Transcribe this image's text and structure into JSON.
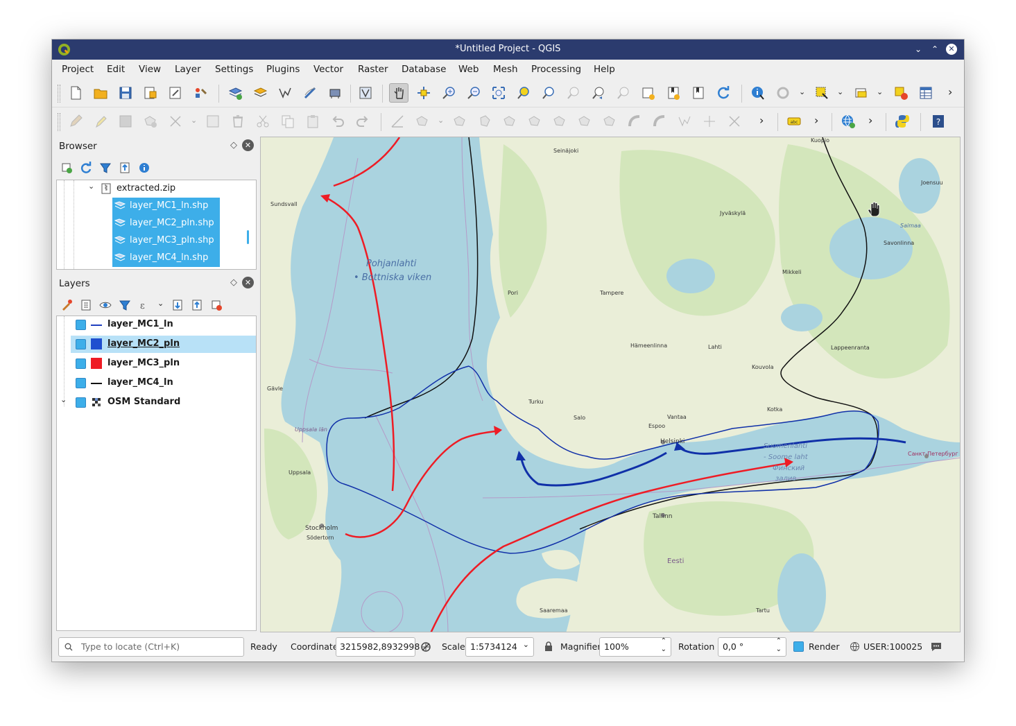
{
  "window": {
    "title": "*Untitled Project - QGIS"
  },
  "menu": [
    "Project",
    "Edit",
    "View",
    "Layer",
    "Settings",
    "Plugins",
    "Vector",
    "Raster",
    "Database",
    "Web",
    "Mesh",
    "Processing",
    "Help"
  ],
  "browser": {
    "title": "Browser",
    "archive": "extracted.zip",
    "files": [
      "layer_MC1_ln.shp",
      "layer_MC2_pln.shp",
      "layer_MC3_pln.shp",
      "layer_MC4_ln.shp"
    ]
  },
  "layers": {
    "title": "Layers",
    "items": [
      {
        "name": "layer_MC1_ln",
        "symbol": "line",
        "color": "#1f3fbf",
        "checked": true,
        "selected": false
      },
      {
        "name": "layer_MC2_pln",
        "symbol": "fill",
        "color": "#1f4fcf",
        "checked": true,
        "selected": true
      },
      {
        "name": "layer_MC3_pln",
        "symbol": "fill",
        "color": "#ee1c25",
        "checked": true,
        "selected": false
      },
      {
        "name": "layer_MC4_ln",
        "symbol": "line",
        "color": "#111111",
        "checked": true,
        "selected": false
      },
      {
        "name": "OSM Standard",
        "symbol": "raster",
        "color": "#333333",
        "checked": true,
        "selected": false
      }
    ]
  },
  "map": {
    "sea_labels": [
      "Pohjanlahti",
      "• Bottniska viken",
      "Suomenlahti",
      "- Soome laht",
      "Финский",
      "залив"
    ],
    "places": [
      "Seinäjoki",
      "Kuopio",
      "Joensuu",
      "Sundsvall",
      "Jyväskylä",
      "Saimaa",
      "Savonlinna",
      "Mikkeli",
      "Pori",
      "Tampere",
      "Hämeenlinna",
      "Lahti",
      "Lappeenranta",
      "Kouvola",
      "Kotka",
      "Turku",
      "Salo",
      "Espoo",
      "Vantaa",
      "Helsinki",
      "Gävle",
      "Uppsala län",
      "Uppsala",
      "Stockholm",
      "Södertorn",
      "Tallinn",
      "Eesti",
      "Saaremaa",
      "Tartu",
      "Санкт-Петербург"
    ],
    "colors": {
      "sea": "#aad3df",
      "land": "#eef0e2",
      "forest": "#cfe3b5",
      "red_route": "#ee1c25",
      "blue_route": "#1030a8",
      "black_route": "#111111"
    }
  },
  "status": {
    "locate_placeholder": "Type to locate (Ctrl+K)",
    "ready": "Ready",
    "coordinate_label": "Coordinate",
    "coordinate": "3215982,8932998",
    "scale_label": "Scale",
    "scale": "1:5734124",
    "magnifier_label": "Magnifier",
    "magnifier": "100%",
    "rotation_label": "Rotation",
    "rotation": "0,0 °",
    "render_label": "Render",
    "crs": "USER:100025"
  }
}
